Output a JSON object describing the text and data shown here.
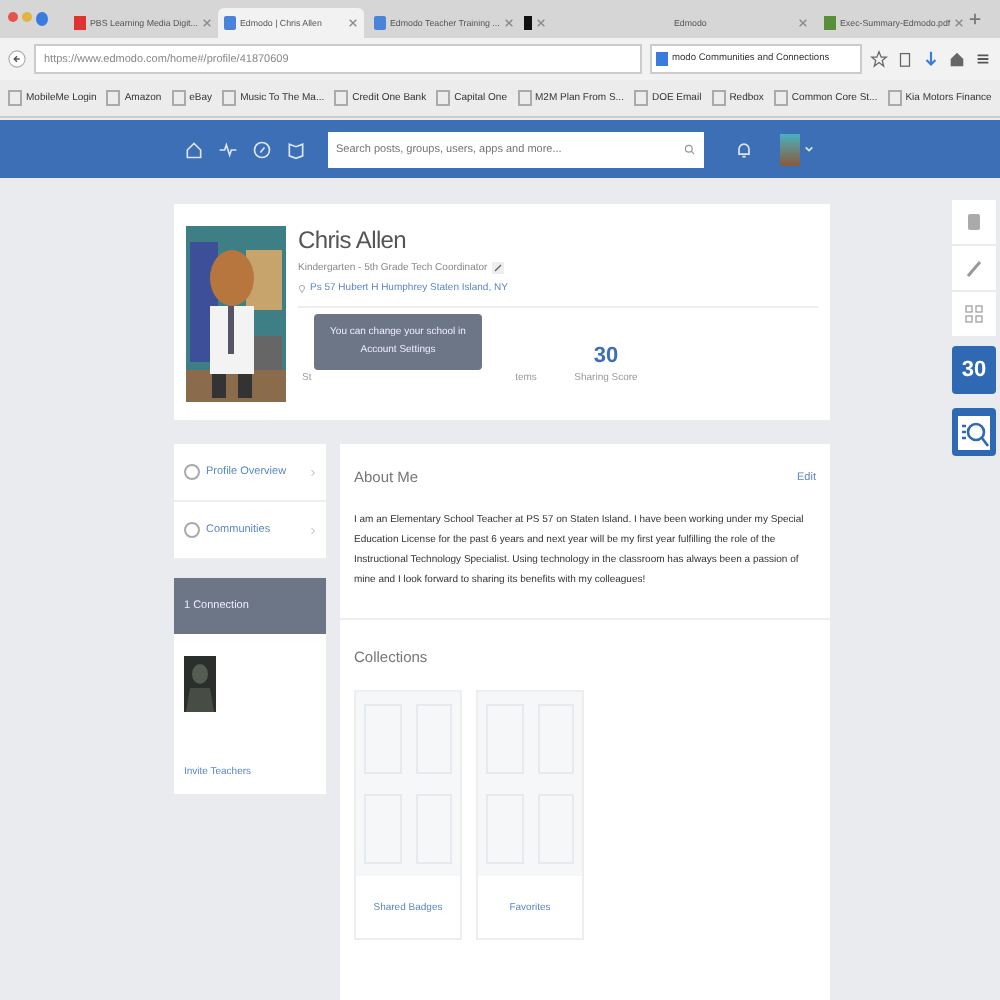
{
  "browser": {
    "tabs": [
      {
        "label": "PBS Learning Media Digit...",
        "selected": false
      },
      {
        "label": "Edmodo | Chris Allen",
        "selected": true
      },
      {
        "label": "Edmodo Teacher Training ...",
        "selected": false
      },
      {
        "selected": false
      },
      {
        "label": "Edmodo",
        "selected": false
      },
      {
        "label": "Exec-Summary-Edmodo.pdf",
        "selected": false
      }
    ],
    "url": "https://www.edmodo.com/home#/profile/41870609",
    "search": "modo Communities and Connections",
    "bookmarks": [
      "MobileMe Login",
      "Amazon",
      "eBay",
      "Music To The Ma...",
      "Credit One Bank",
      "Capital One",
      "M2M Plan From S...",
      "DOE Email",
      "Redbox",
      "Common Core St...",
      "Kia Motors Finance"
    ]
  },
  "nav": {
    "search_placeholder": "Search posts, groups, users, apps and more..."
  },
  "profile": {
    "name": "Chris Allen",
    "title": "Kindergarten - 5th Grade Tech Coordinator",
    "school": "Ps 57 Hubert H Humphrey Staten Island, NY",
    "tooltip": "You can change your school in Account Settings",
    "stats": [
      {
        "label": "St"
      },
      {
        "label": "tems"
      },
      {
        "value": "30",
        "label": "Sharing Score"
      }
    ]
  },
  "sidebar": {
    "items": [
      {
        "label": "Profile Overview"
      },
      {
        "label": "Communities"
      }
    ],
    "connections": {
      "header": "1 Connection",
      "link": "Invite Teachers"
    }
  },
  "about": {
    "title": "About Me",
    "edit": "Edit",
    "text": "I am an Elementary School Teacher at PS 57 on Staten Island.  I have been working under my Special Education License for the past 6 years and next year will be my first year fulfilling the role of the Instructional Technology Specialist.  Using technology in the classroom has always been a passion of mine and I look forward to sharing its benefits with my colleagues!"
  },
  "collections": {
    "title": "Collections",
    "items": [
      "Shared Badges",
      "Favorites"
    ]
  },
  "rail": {
    "calendar_day": "30"
  }
}
